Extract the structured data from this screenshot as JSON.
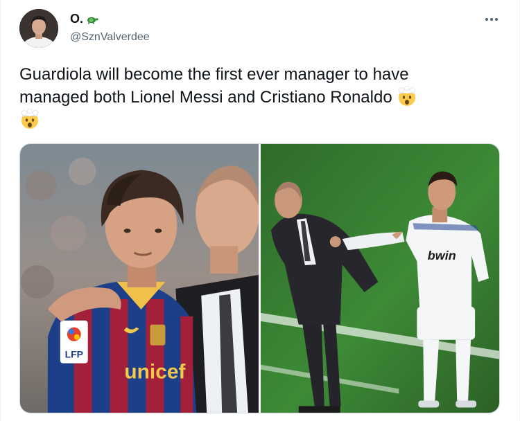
{
  "tweet": {
    "author": {
      "display_name": "O.",
      "name_emoji": "turtle-icon",
      "handle": "@SznValverdee"
    },
    "text_line_1": "Guardiola will become the first ever manager to have",
    "text_line_2": "managed both Lionel Messi and Cristiano Ronaldo",
    "trailing_emoji": [
      "exploding-head-emoji",
      "exploding-head-emoji"
    ],
    "media": [
      {
        "name": "messi-guardiola-photo",
        "labels": {
          "shirt_sponsor": "unicef",
          "league_badge": "LFP"
        }
      },
      {
        "name": "guardiola-ronaldo-photo",
        "labels": {
          "shirt_sponsor": "bwin"
        }
      }
    ]
  },
  "colors": {
    "text_primary": "#0f1419",
    "text_secondary": "#536471",
    "border": "#cfd9de"
  }
}
